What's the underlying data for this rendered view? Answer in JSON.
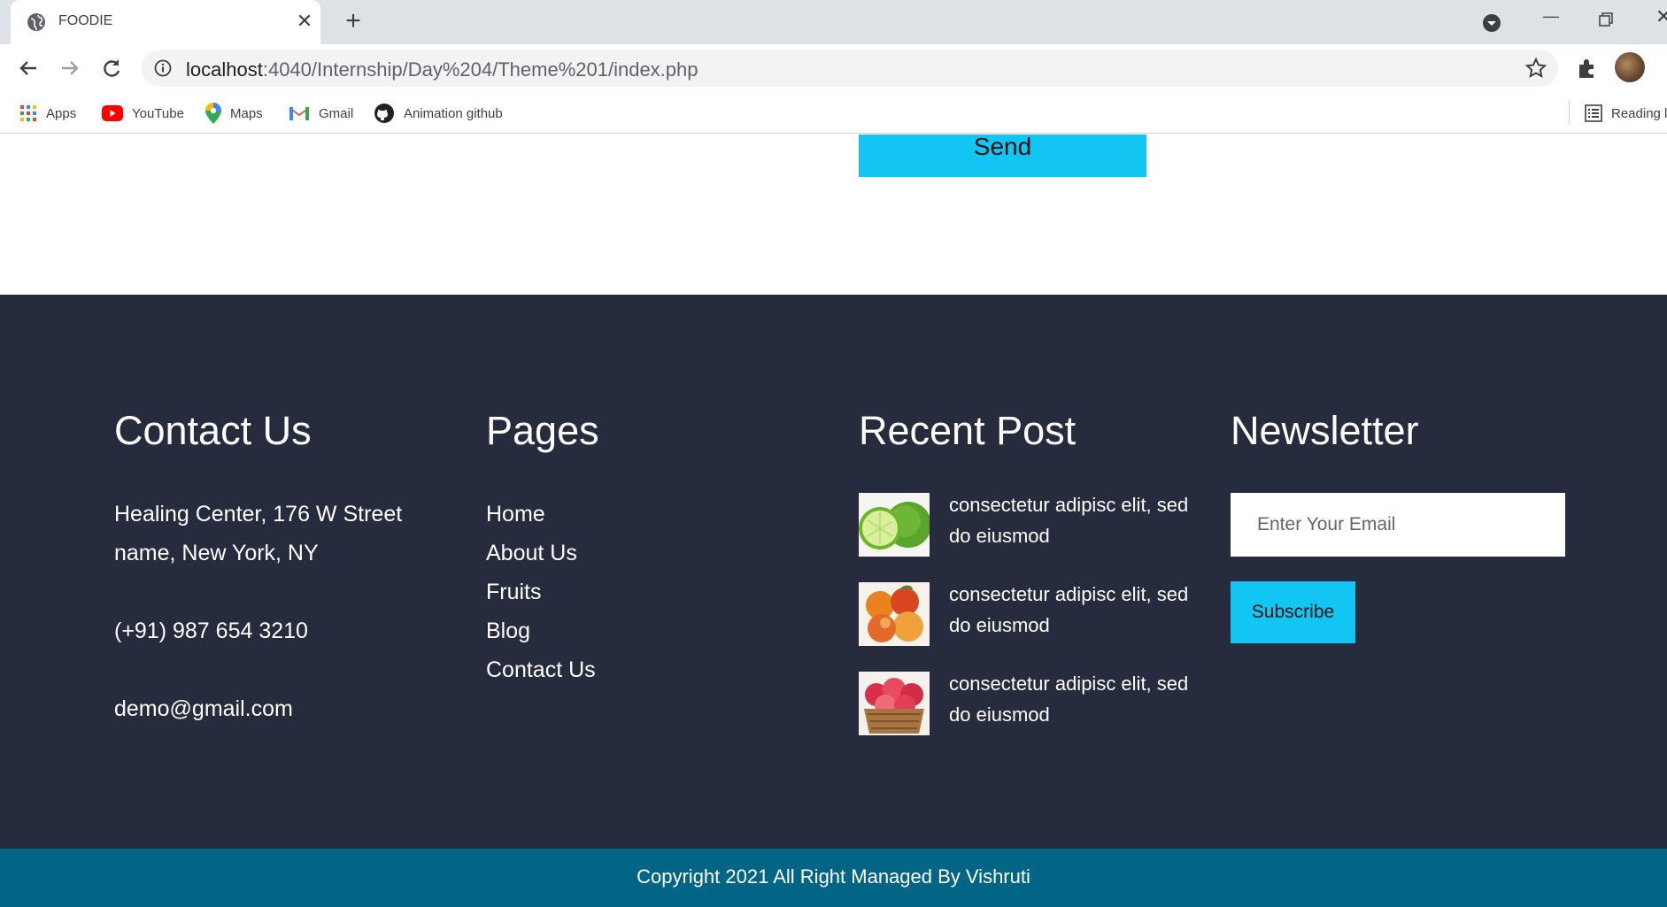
{
  "browser": {
    "tab_title": "FOODIE",
    "url_host": "localhost",
    "url_rest": ":4040/Internship/Day%204/Theme%201/index.php",
    "bookmarks": [
      {
        "label": "Apps",
        "icon": "apps-grid-icon"
      },
      {
        "label": "YouTube",
        "icon": "youtube-icon"
      },
      {
        "label": "Maps",
        "icon": "maps-pin-icon"
      },
      {
        "label": "Gmail",
        "icon": "gmail-icon"
      },
      {
        "label": "Animation github",
        "icon": "github-icon"
      }
    ],
    "reading_list_label": "Reading list"
  },
  "form": {
    "send_label": "Send"
  },
  "footer": {
    "contact": {
      "title": "Contact Us",
      "address": "Healing Center, 176 W Street name, New York, NY",
      "phone": "(+91) 987 654 3210",
      "email": "demo@gmail.com"
    },
    "pages": {
      "title": "Pages",
      "links": [
        "Home",
        "About Us",
        "Fruits",
        "Blog",
        "Contact Us"
      ]
    },
    "recent_post": {
      "title": "Recent Post",
      "posts": [
        {
          "text": "consectetur adipisc elit, sed do eiusmod",
          "image": "lime-image"
        },
        {
          "text": "consectetur adipisc elit, sed do eiusmod",
          "image": "peaches-image"
        },
        {
          "text": "consectetur adipisc elit, sed do eiusmod",
          "image": "apple-basket-image"
        }
      ]
    },
    "newsletter": {
      "title": "Newsletter",
      "email_placeholder": "Enter Your Email",
      "subscribe_label": "Subscribe"
    },
    "copyright": "Copyright 2021 All Right Managed By Vishruti"
  },
  "colors": {
    "accent": "#13c5f2",
    "footer_bg": "#272b3e",
    "copyright_bg": "#036585"
  }
}
